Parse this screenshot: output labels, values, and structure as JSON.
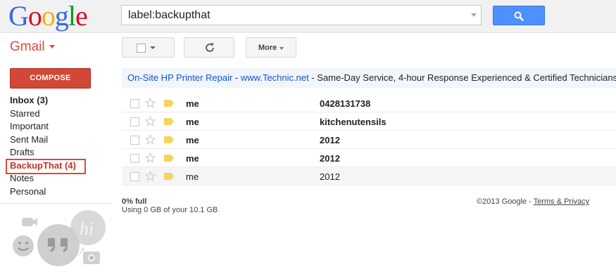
{
  "header": {
    "logo_letters": [
      {
        "char": "G",
        "color": "#3369e8"
      },
      {
        "char": "o",
        "color": "#d50f25"
      },
      {
        "char": "o",
        "color": "#eeb211"
      },
      {
        "char": "g",
        "color": "#3369e8"
      },
      {
        "char": "l",
        "color": "#009925"
      },
      {
        "char": "e",
        "color": "#d50f25"
      }
    ],
    "search_value": "label:backupthat",
    "search_icon": "search-icon"
  },
  "app": {
    "name": "Gmail"
  },
  "toolbar": {
    "more_label": "More"
  },
  "compose_label": "COMPOSE",
  "nav": {
    "items": [
      {
        "label": "Inbox (3)"
      },
      {
        "label": "Starred"
      },
      {
        "label": "Important"
      },
      {
        "label": "Sent Mail"
      },
      {
        "label": "Drafts"
      },
      {
        "label": "BackupThat (4)"
      },
      {
        "label": "Notes"
      },
      {
        "label": "Personal"
      }
    ]
  },
  "ad": {
    "title": "On-Site HP Printer Repair",
    "separator": " - ",
    "url": "www.Technic.net",
    "text": " - Same-Day Service, 4-hour Response Experienced & Certified Technicians"
  },
  "messages": [
    {
      "sender": "me",
      "subject": "0428131738",
      "unread": true
    },
    {
      "sender": "me",
      "subject": "kitchenutensils",
      "unread": true
    },
    {
      "sender": "me",
      "subject": "2012",
      "unread": true
    },
    {
      "sender": "me",
      "subject": "2012",
      "unread": true
    },
    {
      "sender": "me",
      "subject": "2012",
      "unread": false
    }
  ],
  "footer": {
    "usage": "0% full",
    "usage_detail": "Using 0 GB of your 10.1 GB",
    "copyright": "©2013 Google - ",
    "terms_link": "Terms & Privacy"
  },
  "colors": {
    "accent_red": "#dd4b39",
    "search_blue": "#4d90fe",
    "link_blue": "#1155cc"
  }
}
